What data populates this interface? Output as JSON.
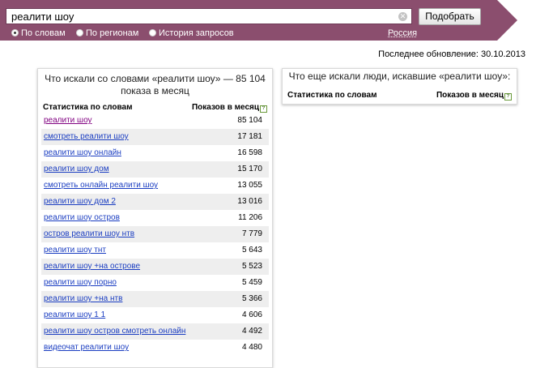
{
  "search": {
    "query": "реалити шоу",
    "submit_label": "Подобрать"
  },
  "modes": [
    {
      "label": "По словам",
      "checked": true
    },
    {
      "label": "По регионам",
      "checked": false
    },
    {
      "label": "История запросов",
      "checked": false
    }
  ],
  "region": "Россия",
  "updated": "Последнее обновление: 30.10.2013",
  "left_panel": {
    "title_line1": "Что искали со словами «реалити шоу» — 85 104",
    "title_line2": "показа в месяц",
    "col_words": "Статистика по словам",
    "col_shows": "Показов в месяц",
    "help": "?",
    "rows": [
      {
        "phrase": "реалити шоу",
        "count": "85 104"
      },
      {
        "phrase": "смотреть реалити шоу",
        "count": "17 181"
      },
      {
        "phrase": "реалити шоу онлайн",
        "count": "16 598"
      },
      {
        "phrase": "реалити шоу дом",
        "count": "15 170"
      },
      {
        "phrase": "смотреть онлайн реалити шоу",
        "count": "13 055"
      },
      {
        "phrase": "реалити шоу дом 2",
        "count": "13 016"
      },
      {
        "phrase": "реалити шоу остров",
        "count": "11 206"
      },
      {
        "phrase": "остров реалити шоу нтв",
        "count": "7 779"
      },
      {
        "phrase": "реалити шоу тнт",
        "count": "5 643"
      },
      {
        "phrase": "реалити шоу +на острове",
        "count": "5 523"
      },
      {
        "phrase": "реалити шоу порно",
        "count": "5 459"
      },
      {
        "phrase": "реалити шоу +на нтв",
        "count": "5 366"
      },
      {
        "phrase": "реалити шоу 1 1",
        "count": "4 606"
      },
      {
        "phrase": "реалити шоу остров смотреть онлайн",
        "count": "4 492"
      },
      {
        "phrase": "видеочат реалити шоу",
        "count": "4 480"
      }
    ]
  },
  "right_panel": {
    "title": "Что еще искали люди, искавшие «реалити шоу»:",
    "col_words": "Статистика по словам",
    "col_shows": "Показов в месяц",
    "help": "?"
  }
}
